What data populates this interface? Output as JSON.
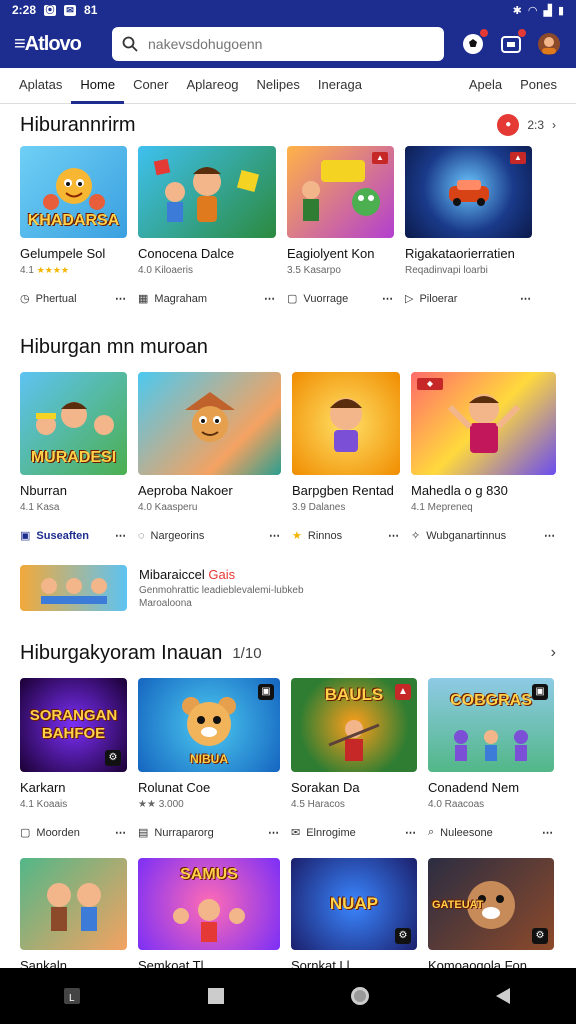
{
  "status": {
    "time": "2:28",
    "right": "81"
  },
  "appbar": {
    "logo": "≡Atlovo",
    "search_placeholder": "nakevsdohugoenn"
  },
  "tabs": [
    "Aplatas",
    "Home",
    "Coner",
    "Aplareog",
    "Nelipes",
    "Ineraga",
    "Apela",
    "Pones"
  ],
  "s1": {
    "title": "Hiburannrirm",
    "right_text": "2:3",
    "cards": [
      {
        "img": "KHADARSA",
        "title": "Gelumpele Sol",
        "sub": "4.1",
        "stars": "★★★★",
        "act": "Phertual"
      },
      {
        "img": "",
        "title": "Conocena Dalce",
        "sub": "4.0 Kiloaeris",
        "act": "Magraham"
      },
      {
        "img": "",
        "title": "Eagiolyent Kon",
        "sub": "3.5 Kasarpo",
        "act": "Vuorrage"
      },
      {
        "img": "",
        "title": "Rigakataorierratien",
        "sub": "Reqadinvapi loarbi",
        "act": "Piloerar"
      }
    ]
  },
  "s2": {
    "title": "Hiburgan mn muroan",
    "cards": [
      {
        "img": "MURADESI",
        "title": "Nburran",
        "sub": "4.1 Kasa",
        "act": "Suseaften"
      },
      {
        "img": "",
        "title": "Aeproba Nakoer",
        "sub": "4.0 Kaasperu",
        "act": "Nargeorins"
      },
      {
        "img": "",
        "title": "Barpgben Rentad",
        "sub": "3.9 Dalanes",
        "act": "Rinnos"
      },
      {
        "img": "",
        "title": "Mahedla o g 830",
        "sub": "4.1 Mepreneq",
        "act": "Wubganartinnus"
      }
    ],
    "promo": {
      "title": "Mibaraiccel",
      "highlight": "Gais",
      "line1": "Genmohrattic leadieblevalemi-lubkeb",
      "line2": "Maroaloona"
    }
  },
  "s3": {
    "title": "Hiburgakyoram Inauan",
    "count": "1/10",
    "cards": [
      {
        "img": "SORANGAN BAHFOE",
        "title": "Karkarn",
        "sub": "4.1 Koaais",
        "act": "Moorden"
      },
      {
        "img": "NIBUA",
        "title": "Rolunat Coe",
        "sub": "★★ 3.000",
        "act": "Nurraparorg"
      },
      {
        "img": "BAULS",
        "title": "Sorakan Da",
        "sub": "4.5 Haracos",
        "act": "Elnrogime"
      },
      {
        "img": "COBGRAS",
        "title": "Conadend Nem",
        "sub": "4.0 Raacoas",
        "act": "Nuleesone"
      }
    ]
  },
  "s4": {
    "cards": [
      {
        "img": "",
        "title": "Sankaln"
      },
      {
        "img": "SAMUS",
        "title": "Semkoat Tl"
      },
      {
        "img": "NUAP",
        "title": "Sornkat Ll"
      },
      {
        "img": "GATEUAT",
        "title": "Komoaogola Fon"
      }
    ]
  },
  "colors": {
    "primary": "#1c2c8f",
    "accent": "#e53935",
    "star": "#f5b400"
  },
  "icons": [
    "search-icon",
    "soccer-icon",
    "wallet-icon",
    "profile-icon",
    "home-nav-icon",
    "back-nav-icon"
  ]
}
